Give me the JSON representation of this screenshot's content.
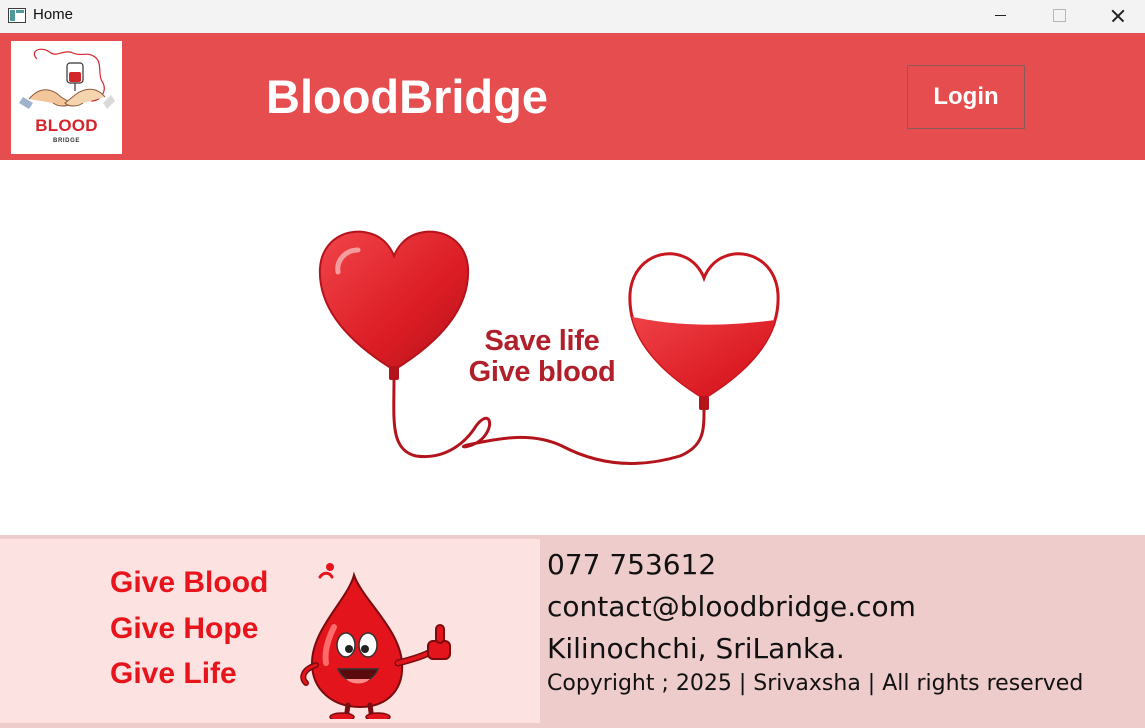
{
  "window": {
    "title": "Home"
  },
  "header": {
    "logo": {
      "word": "BLOOD",
      "subword": "BRIDGE"
    },
    "brand": "BloodBridge",
    "login_label": "Login",
    "background": "#e54d4f"
  },
  "hero": {
    "line1": "Save life",
    "line2": "Give blood",
    "accent": "#c8161e"
  },
  "footer": {
    "slogans": [
      "Give Blood",
      "Give Hope",
      "Give Life"
    ],
    "phone": "077 753612",
    "email": "contact@bloodbridge.com",
    "address": "Kilinochchi, SriLanka.",
    "copyright": "Copyright ; 2025 | Srivaxsha | All rights reserved",
    "background_left": "#fde2e2",
    "background_right": "#eecccc"
  },
  "icons": [
    "app-window-icon",
    "blood-bridge-logo-icon",
    "heart-balloon-icon",
    "blood-drop-mascot-icon"
  ]
}
